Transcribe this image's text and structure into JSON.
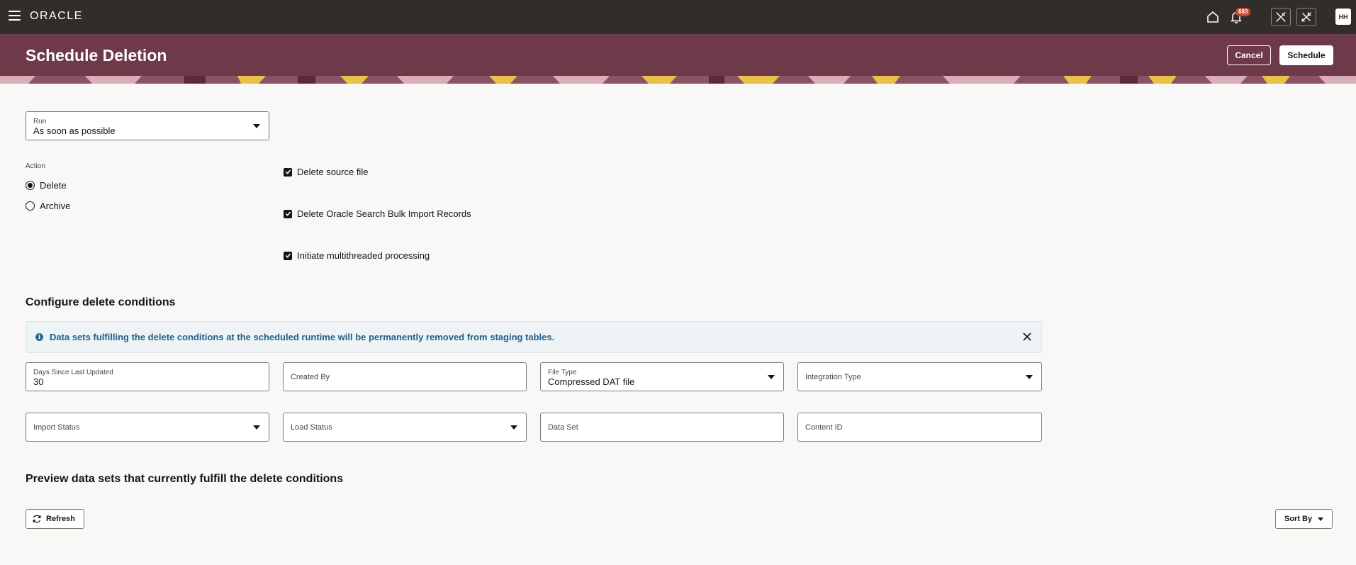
{
  "topbar": {
    "brand": "ORACLE",
    "notifications_count": "883",
    "user_initials": "HH"
  },
  "header": {
    "title": "Schedule Deletion",
    "cancel_label": "Cancel",
    "schedule_label": "Schedule"
  },
  "run": {
    "label": "Run",
    "value": "As soon as possible"
  },
  "action": {
    "label": "Action",
    "options": [
      {
        "label": "Delete",
        "selected": true
      },
      {
        "label": "Archive",
        "selected": false
      }
    ]
  },
  "checkboxes": [
    {
      "label": "Delete source file",
      "checked": true
    },
    {
      "label": "Delete Oracle Search Bulk Import Records",
      "checked": true
    },
    {
      "label": "Initiate multithreaded processing",
      "checked": true
    }
  ],
  "conditions": {
    "title": "Configure delete conditions",
    "info_message": "Data sets fulfilling the delete conditions at the scheduled runtime will be permanently removed from staging tables.",
    "fields": {
      "days_label": "Days Since Last Updated",
      "days_value": "30",
      "created_by": "Created By",
      "file_type_label": "File Type",
      "file_type_value": "Compressed DAT file",
      "integration_type": "Integration Type",
      "import_status": "Import Status",
      "load_status": "Load Status",
      "data_set": "Data Set",
      "content_id": "Content ID"
    }
  },
  "preview": {
    "title": "Preview data sets that currently fulfill the delete conditions",
    "refresh_label": "Refresh",
    "sort_label": "Sort By"
  },
  "colors": {
    "topbar": "#312d2a",
    "banner": "#6e3a4a",
    "info_text": "#1f5f86",
    "badge": "#c74634"
  }
}
